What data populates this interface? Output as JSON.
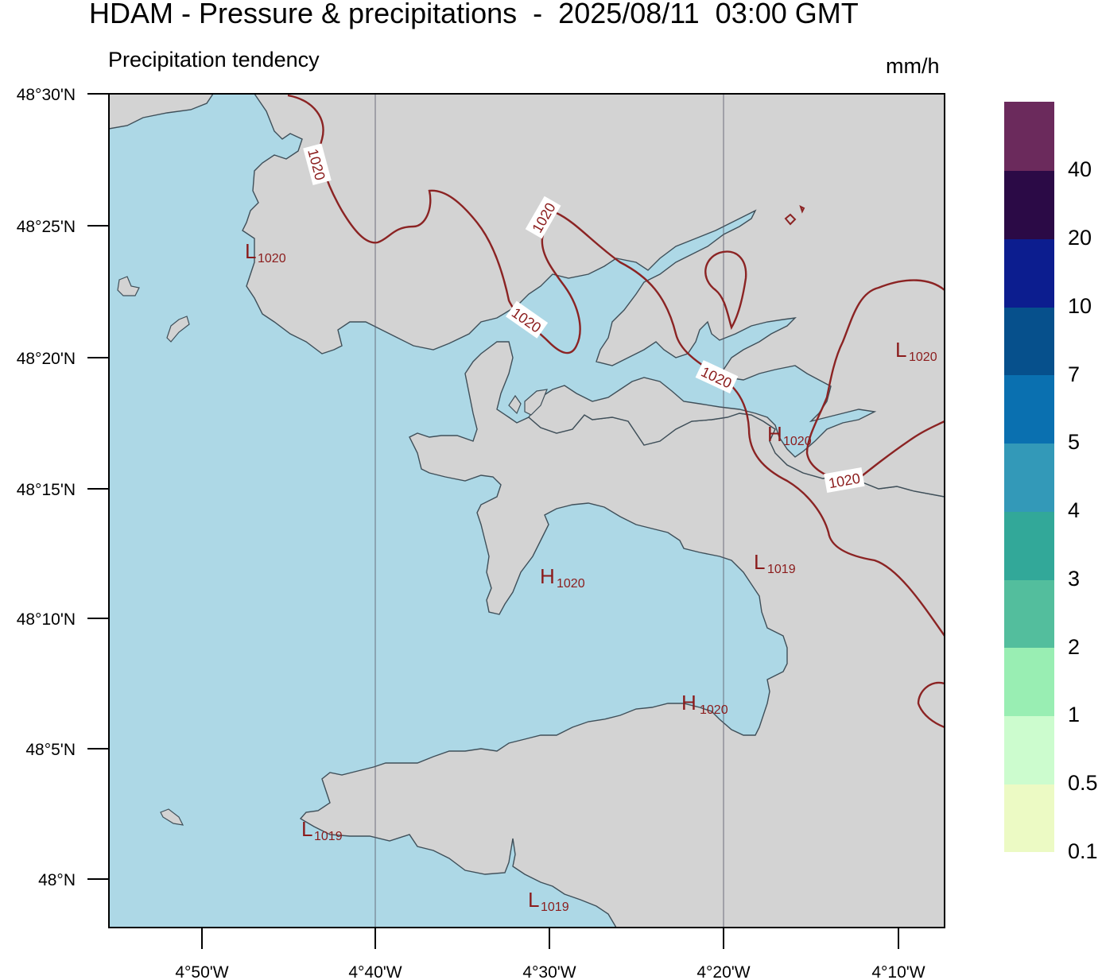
{
  "header": {
    "title": "HDAM - Pressure & precipitations  -  2025/08/11  03:00 GMT",
    "subtitle": "Precipitation tendency",
    "units": "mm/h"
  },
  "axes": {
    "lat_labels": [
      "48°30'N",
      "48°25'N",
      "48°20'N",
      "48°15'N",
      "48°10'N",
      "48°5'N",
      "48°N"
    ],
    "lon_labels": [
      "4°50'W",
      "4°40'W",
      "4°30'W",
      "4°20'W",
      "4°10'W"
    ]
  },
  "colors": {
    "sea": "#add8e6",
    "land": "#d3d3d3",
    "coast": "#3f4f59",
    "isobar": "#8b2323"
  },
  "isobar_labels": [
    "1020",
    "1020",
    "1020",
    "1020",
    "1020"
  ],
  "pressure_markers": [
    {
      "type": "L",
      "value": "1020"
    },
    {
      "type": "L",
      "value": "1020"
    },
    {
      "type": "H",
      "value": "1020"
    },
    {
      "type": "H",
      "value": "1020"
    },
    {
      "type": "L",
      "value": "1019"
    },
    {
      "type": "H",
      "value": "1020"
    },
    {
      "type": "L",
      "value": "1019"
    },
    {
      "type": "L",
      "value": "1019"
    }
  ],
  "colorbar": {
    "labels": [
      "40",
      "20",
      "10",
      "7",
      "5",
      "4",
      "3",
      "2",
      "1",
      "0.5",
      "0.1"
    ],
    "colors": [
      "#6b2a5c",
      "#2b0a46",
      "#0c1d8f",
      "#06508c",
      "#0a70b0",
      "#3399b8",
      "#32a899",
      "#53be9d",
      "#99eeb3",
      "#ccfcce",
      "#ecfac4"
    ]
  }
}
